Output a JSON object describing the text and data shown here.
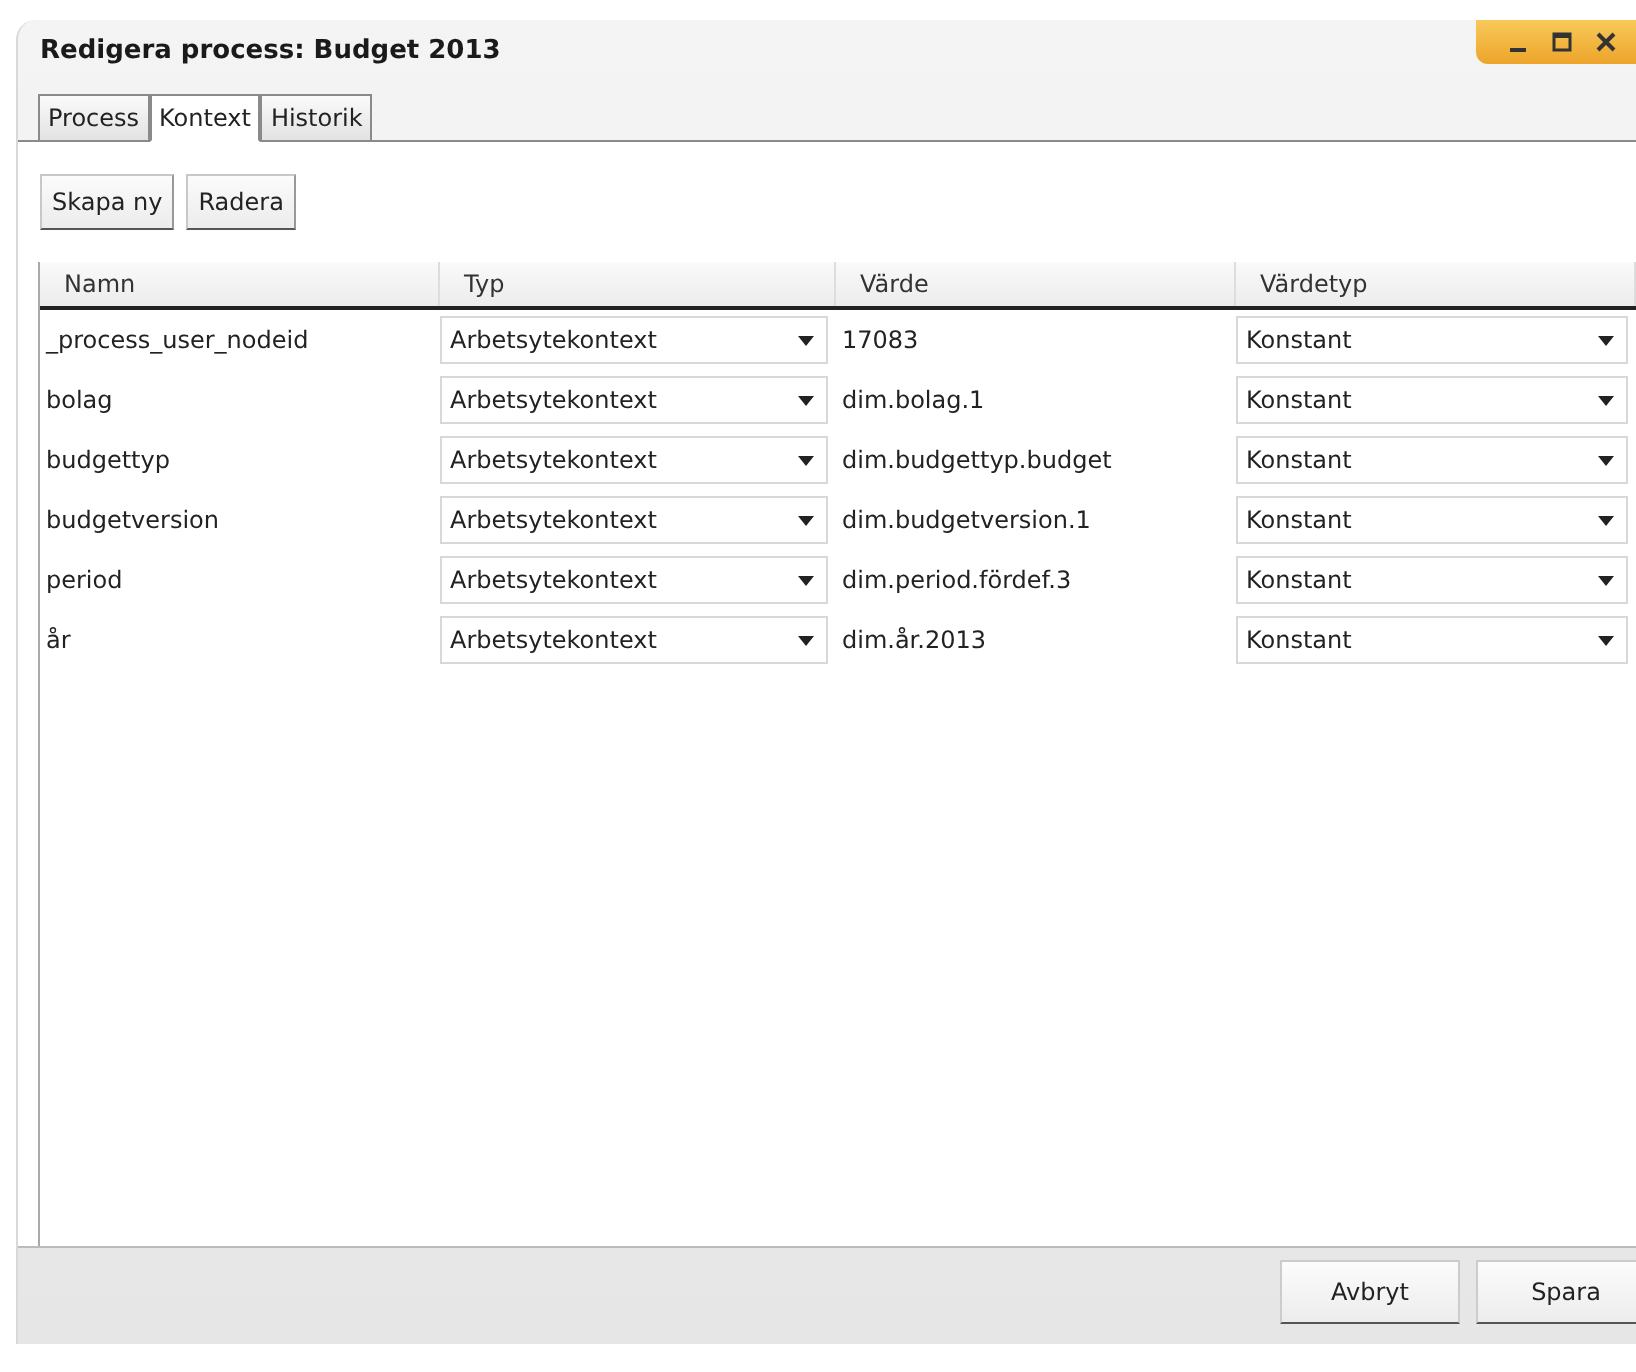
{
  "window": {
    "title": "Redigera process: Budget 2013"
  },
  "tabs": [
    {
      "label": "Process",
      "selected": false
    },
    {
      "label": "Kontext",
      "selected": true
    },
    {
      "label": "Historik",
      "selected": false
    }
  ],
  "toolbar": [
    "Skapa ny",
    "Radera"
  ],
  "table": {
    "columns": [
      "Namn",
      "Typ",
      "Värde",
      "Värdetyp"
    ],
    "rows": [
      {
        "name": "_process_user_nodeid",
        "type": "Arbetsytekontext",
        "value": "17083",
        "value_type": "Konstant"
      },
      {
        "name": "bolag",
        "type": "Arbetsytekontext",
        "value": "dim.bolag.1",
        "value_type": "Konstant"
      },
      {
        "name": "budgettyp",
        "type": "Arbetsytekontext",
        "value": "dim.budgettyp.budget",
        "value_type": "Konstant"
      },
      {
        "name": "budgetversion",
        "type": "Arbetsytekontext",
        "value": "dim.budgetversion.1",
        "value_type": "Konstant"
      },
      {
        "name": "period",
        "type": "Arbetsytekontext",
        "value": "dim.period.fördef.3",
        "value_type": "Konstant"
      },
      {
        "name": "år",
        "type": "Arbetsytekontext",
        "value": "dim.år.2013",
        "value_type": "Konstant"
      }
    ]
  },
  "footer_buttons": [
    "Avbryt",
    "Spara"
  ]
}
